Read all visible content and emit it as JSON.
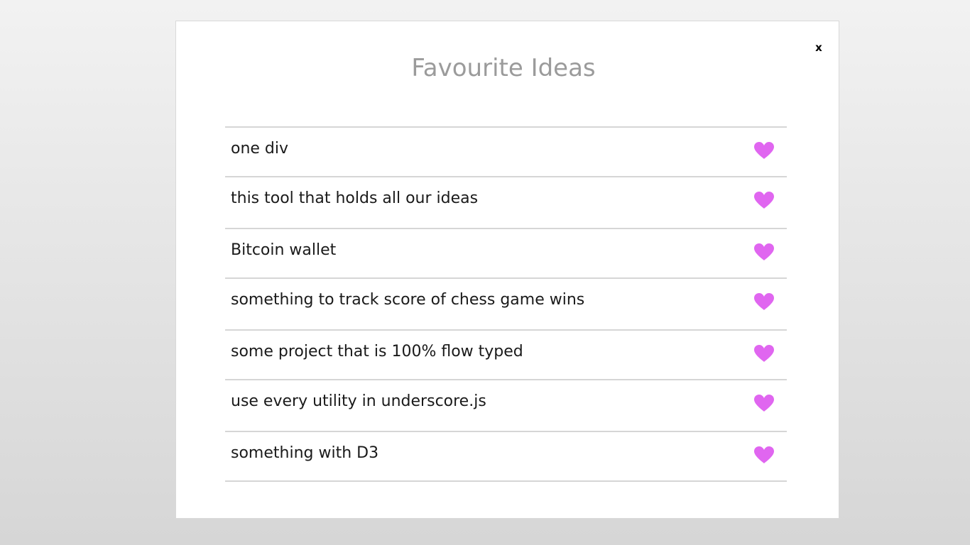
{
  "modal": {
    "title": "Favourite Ideas",
    "close_label": "x",
    "heart_color": "#e066f0",
    "ideas": [
      {
        "text": "one div"
      },
      {
        "text": "this tool that holds all our ideas"
      },
      {
        "text": "Bitcoin wallet"
      },
      {
        "text": "something to track score of chess game wins"
      },
      {
        "text": "some project that is 100% flow typed"
      },
      {
        "text": "use every utility in underscore.js"
      },
      {
        "text": "something with D3"
      }
    ]
  }
}
